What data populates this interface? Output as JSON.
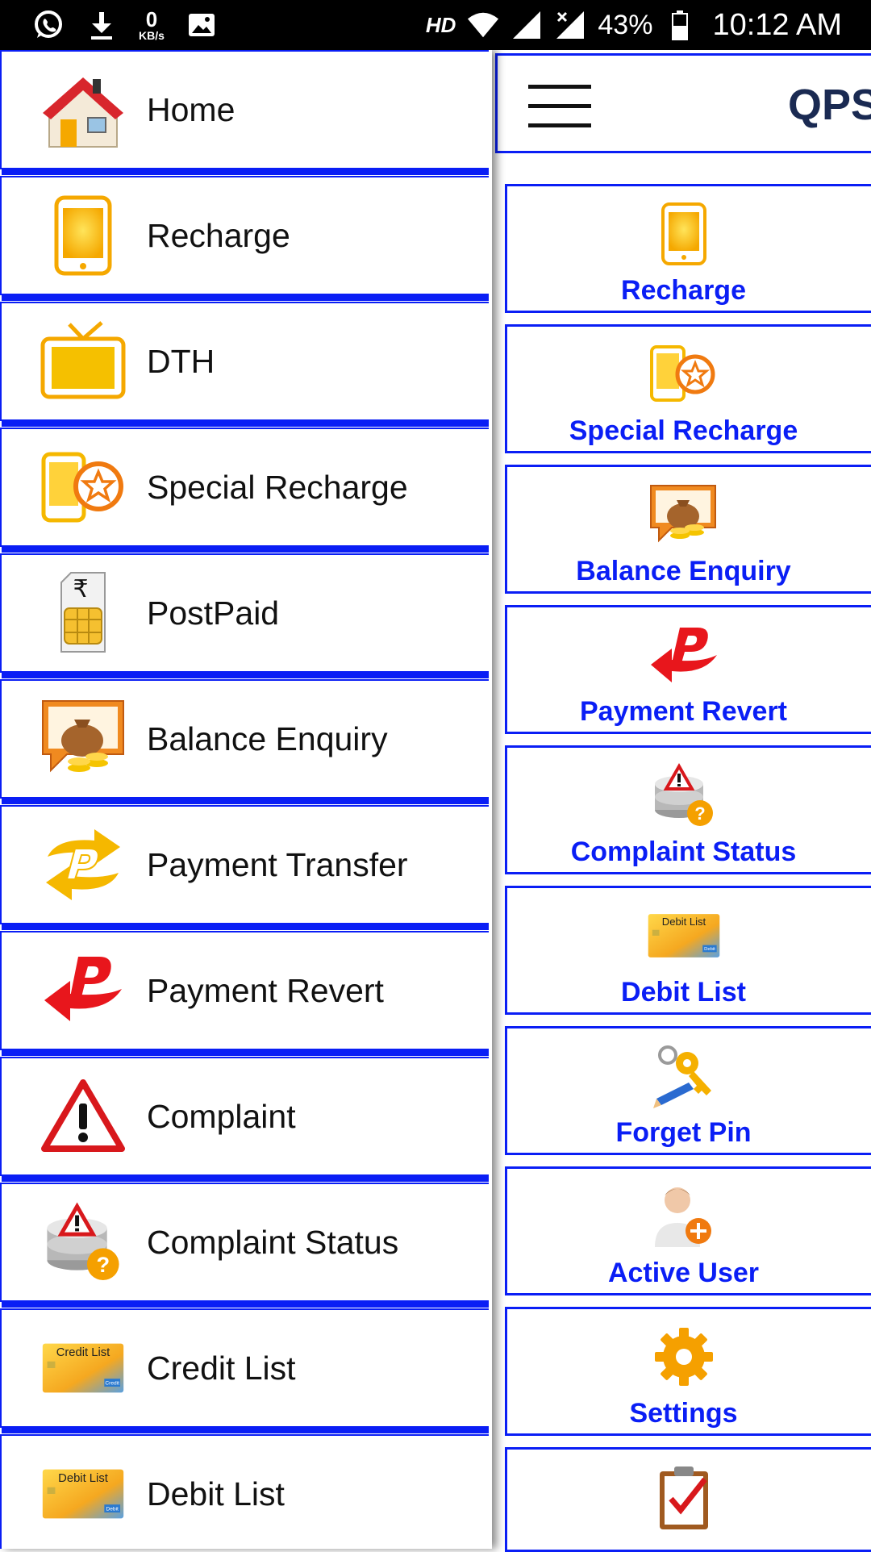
{
  "status_bar": {
    "kbs_value": "0",
    "kbs_unit": "KB/s",
    "hd": "HD",
    "battery": "43%",
    "time": "10:12 AM"
  },
  "drawer": {
    "items": [
      {
        "label": "Home",
        "icon": "home-icon"
      },
      {
        "label": "Recharge",
        "icon": "mobile-phone-icon"
      },
      {
        "label": "DTH",
        "icon": "tv-icon"
      },
      {
        "label": "Special Recharge",
        "icon": "phone-star-icon"
      },
      {
        "label": "PostPaid",
        "icon": "sim-card-icon"
      },
      {
        "label": "Balance Enquiry",
        "icon": "money-bag-icon"
      },
      {
        "label": "Payment Transfer",
        "icon": "payment-transfer-icon"
      },
      {
        "label": "Payment Revert",
        "icon": "payment-revert-icon"
      },
      {
        "label": "Complaint",
        "icon": "warning-icon"
      },
      {
        "label": "Complaint Status",
        "icon": "complaint-status-icon"
      },
      {
        "label": "Credit List",
        "icon": "credit-card-icon"
      },
      {
        "label": "Debit List",
        "icon": "debit-card-icon"
      }
    ]
  },
  "card_text": {
    "credit": "Credit List",
    "debit": "Debit List",
    "credit_badge": "Credit",
    "debit_badge": "Debit"
  },
  "header": {
    "title": "QPS"
  },
  "tiles": [
    {
      "label": "Recharge",
      "icon": "mobile-phone-icon"
    },
    {
      "label": "Special Recharge",
      "icon": "phone-star-icon"
    },
    {
      "label": "Balance Enquiry",
      "icon": "money-bag-icon"
    },
    {
      "label": "Payment Revert",
      "icon": "payment-revert-icon"
    },
    {
      "label": "Complaint Status",
      "icon": "complaint-status-icon"
    },
    {
      "label": "Debit List",
      "icon": "debit-card-icon"
    },
    {
      "label": "Forget Pin",
      "icon": "key-pencil-icon"
    },
    {
      "label": "Active User",
      "icon": "add-user-icon"
    },
    {
      "label": "Settings",
      "icon": "gear-icon"
    },
    {
      "label": "",
      "icon": "clipboard-check-icon"
    }
  ],
  "colors": {
    "accent_blue": "#0a1ef5",
    "title_navy": "#1a2a52",
    "icon_yellow": "#f5b800"
  }
}
